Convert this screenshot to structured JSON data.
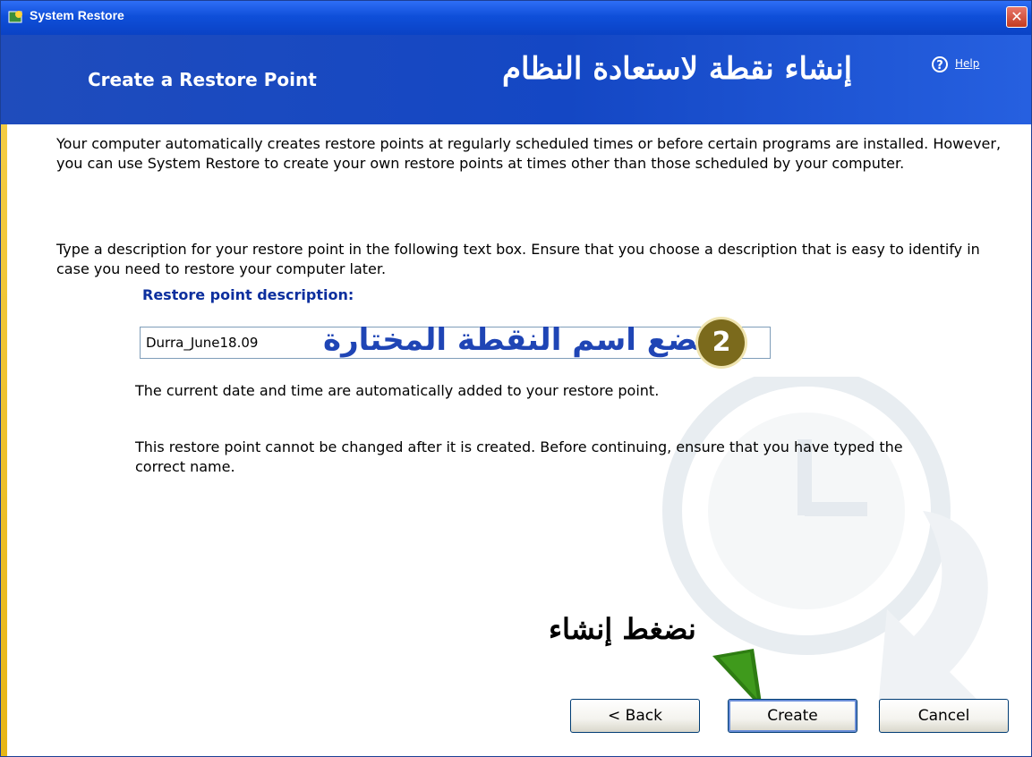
{
  "window": {
    "title": "System Restore",
    "close_glyph": "✕"
  },
  "header": {
    "title": "Create a Restore Point",
    "arabic_title": "إنشاء نقطة لاستعادة النظام",
    "help_icon": "question-circle-icon",
    "help_link": "Help"
  },
  "content": {
    "intro": "Your computer automatically creates restore points at regularly scheduled times or before certain programs are installed. However, you can use System Restore to create your own restore points at times other than those scheduled by your computer.",
    "instruction": "Type a description for your restore point in the following text box. Ensure that you choose a description that is easy to identify in case you need to restore your computer later.",
    "field_label": "Restore point description:",
    "field_value": "Durra_June18.09",
    "overlay_arabic": "نضع اسم النقطة المختارة",
    "step_number": "2",
    "date_note": "The current date and time are automatically added to your restore point.",
    "warning": "This restore point cannot be changed after it is created. Before continuing, ensure that you have typed the correct name.",
    "press_arabic": "نضغط إنشاء"
  },
  "buttons": {
    "back": "< Back",
    "create": "Create",
    "cancel": "Cancel"
  },
  "colors": {
    "title_bar": "#0f4fd9",
    "header_band": "#1447c4",
    "label_blue": "#0c2f9e",
    "badge": "#7b6a1c",
    "arrow": "#2e7d12"
  }
}
